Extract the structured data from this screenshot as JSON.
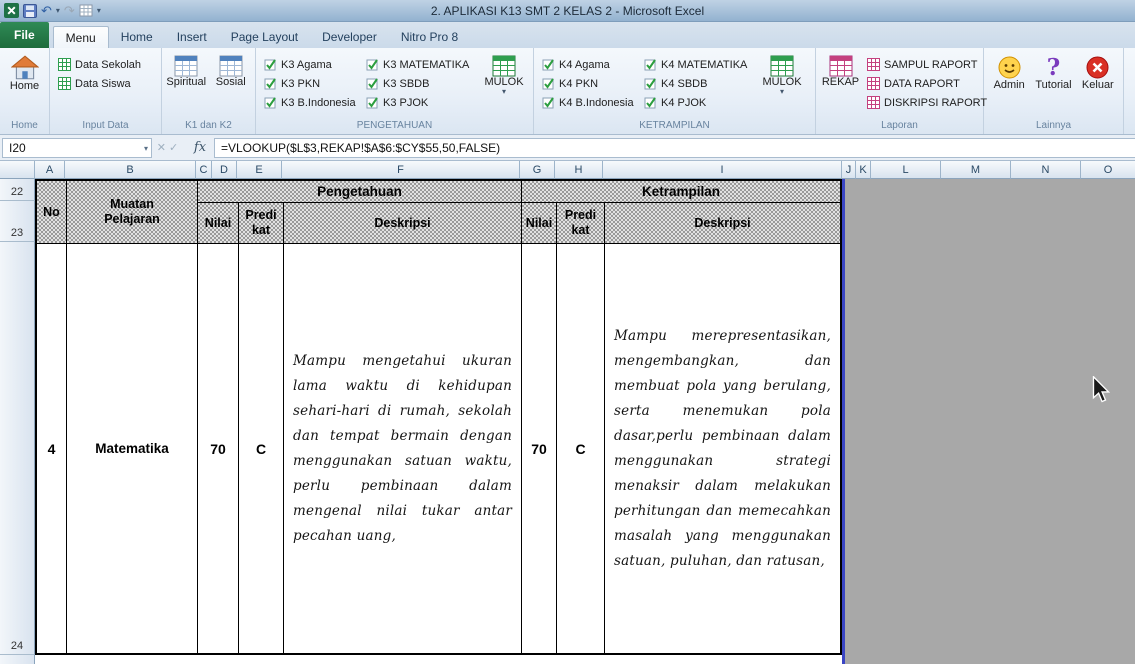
{
  "window": {
    "title": "2. APLIKASI K13 SMT 2 KELAS 2  -  Microsoft Excel",
    "active_tab": "Menu"
  },
  "quick_access": {
    "icons": [
      "excel",
      "save",
      "undo",
      "redo",
      "print",
      "customize-dropdown"
    ]
  },
  "tabs": {
    "file": "File",
    "menu": "Menu",
    "home": "Home",
    "insert": "Insert",
    "page_layout": "Page Layout",
    "developer": "Developer",
    "nitro": "Nitro Pro 8"
  },
  "ribbon": {
    "home": {
      "label": "Home",
      "button": "Home"
    },
    "input_data": {
      "label": "Input Data",
      "buttons": [
        "Data Sekolah",
        "Data Siswa"
      ]
    },
    "k1k2": {
      "label": "K1 dan K2",
      "buttons": [
        "Spiritual",
        "Sosial"
      ]
    },
    "pengetahuan": {
      "label": "PENGETAHUAN",
      "buttons": [
        "K3 Agama",
        "K3 PKN",
        "K3 B.Indonesia",
        "K3 MATEMATIKA",
        "K3 SBDB",
        "K3 PJOK"
      ],
      "mulok": "MULOK"
    },
    "ketrampilan": {
      "label": "KETRAMPILAN",
      "buttons": [
        "K4 Agama",
        "K4 PKN",
        "K4 B.Indonesia",
        "K4 MATEMATIKA",
        "K4 SBDB",
        "K4 PJOK"
      ],
      "mulok": "MULOK"
    },
    "laporan": {
      "label": "Laporan",
      "rekap": "REKAP",
      "buttons": [
        "SAMPUL RAPORT",
        "DATA RAPORT",
        "DISKRIPSI RAPORT"
      ]
    },
    "lainnya": {
      "label": "Lainnya",
      "buttons": [
        "Admin",
        "Tutorial",
        "Keluar"
      ]
    }
  },
  "formula_bar": {
    "name_box": "I20",
    "fx": "fx",
    "formula": "=VLOOKUP($L$3,REKAP!$A$6:$CY$55,50,FALSE)"
  },
  "sheet": {
    "columns": [
      "A",
      "B",
      "C",
      "D",
      "E",
      "F",
      "G",
      "H",
      "I",
      "J",
      "K",
      "L",
      "M",
      "N",
      "O"
    ],
    "row_numbers": [
      "22",
      "23",
      "24"
    ],
    "header": {
      "no": "No",
      "muatan": "Muatan Pelajaran",
      "pengetahuan": "Pengetahuan",
      "ketrampilan": "Ketrampilan",
      "nilai": "Nilai",
      "predikat": "Predi kat",
      "deskripsi": "Deskripsi"
    },
    "row24": {
      "no": "4",
      "muatan": "Matematika",
      "pengetahuan_nilai": "70",
      "pengetahuan_predikat": "C",
      "pengetahuan_deskripsi": "Mampu mengetahui ukuran lama waktu di kehidupan sehari-hari di rumah, sekolah dan tempat bermain dengan menggunakan satuan waktu, perlu pembinaan dalam mengenal nilai tukar antar pecahan uang,",
      "ketrampilan_nilai": "70",
      "ketrampilan_predikat": "C",
      "ketrampilan_deskripsi": "Mampu merepresentasikan, mengembangkan, dan membuat pola yang berulang, serta menemukan pola dasar,perlu pembinaan dalam menggunakan strategi menaksir dalam melakukan perhitungan dan memecahkan masalah yang menggunakan satuan, puluhan, dan ratusan,"
    }
  },
  "colors": {
    "file_tab_green": "#1e7145",
    "page_break_blue": "#3a45c4",
    "outside_sheet_gray": "#a8a8a8"
  }
}
